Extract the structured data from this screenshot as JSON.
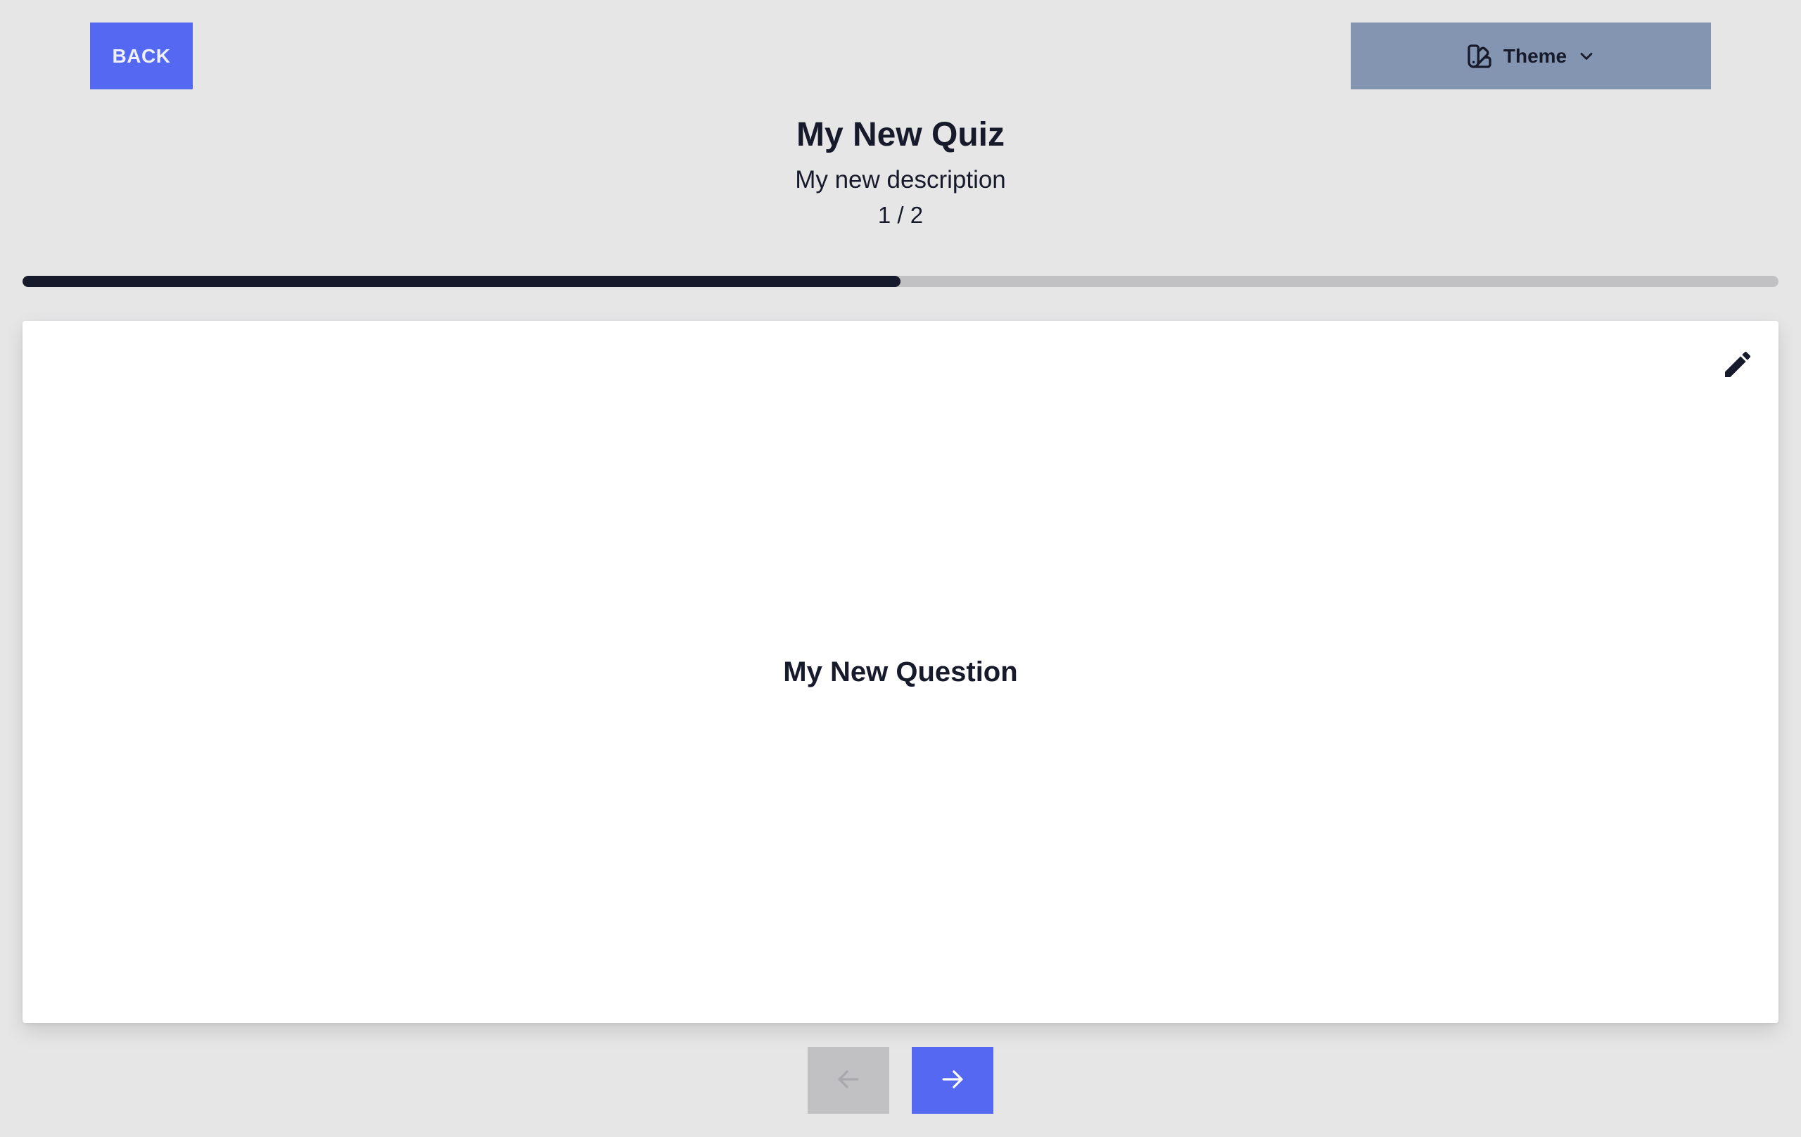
{
  "toolbar": {
    "back_label": "BACK",
    "theme_label": "Theme"
  },
  "quiz": {
    "title": "My New Quiz",
    "description": "My new description",
    "counter": "1 / 2",
    "progress": 0.5
  },
  "question": {
    "text": "My New Question"
  },
  "icons": {
    "theme": "swatch-book-icon",
    "theme_dropdown": "chevron-down-icon",
    "edit": "pencil-icon",
    "prev": "arrow-left-icon",
    "next": "arrow-right-icon"
  },
  "colors": {
    "background": "#e6e6e7",
    "accent": "#5468f2",
    "theme_button": "#8495b2",
    "text_dark": "#161a2b",
    "progress_track": "#c1c1c3",
    "disabled": "#c1c1c3"
  }
}
